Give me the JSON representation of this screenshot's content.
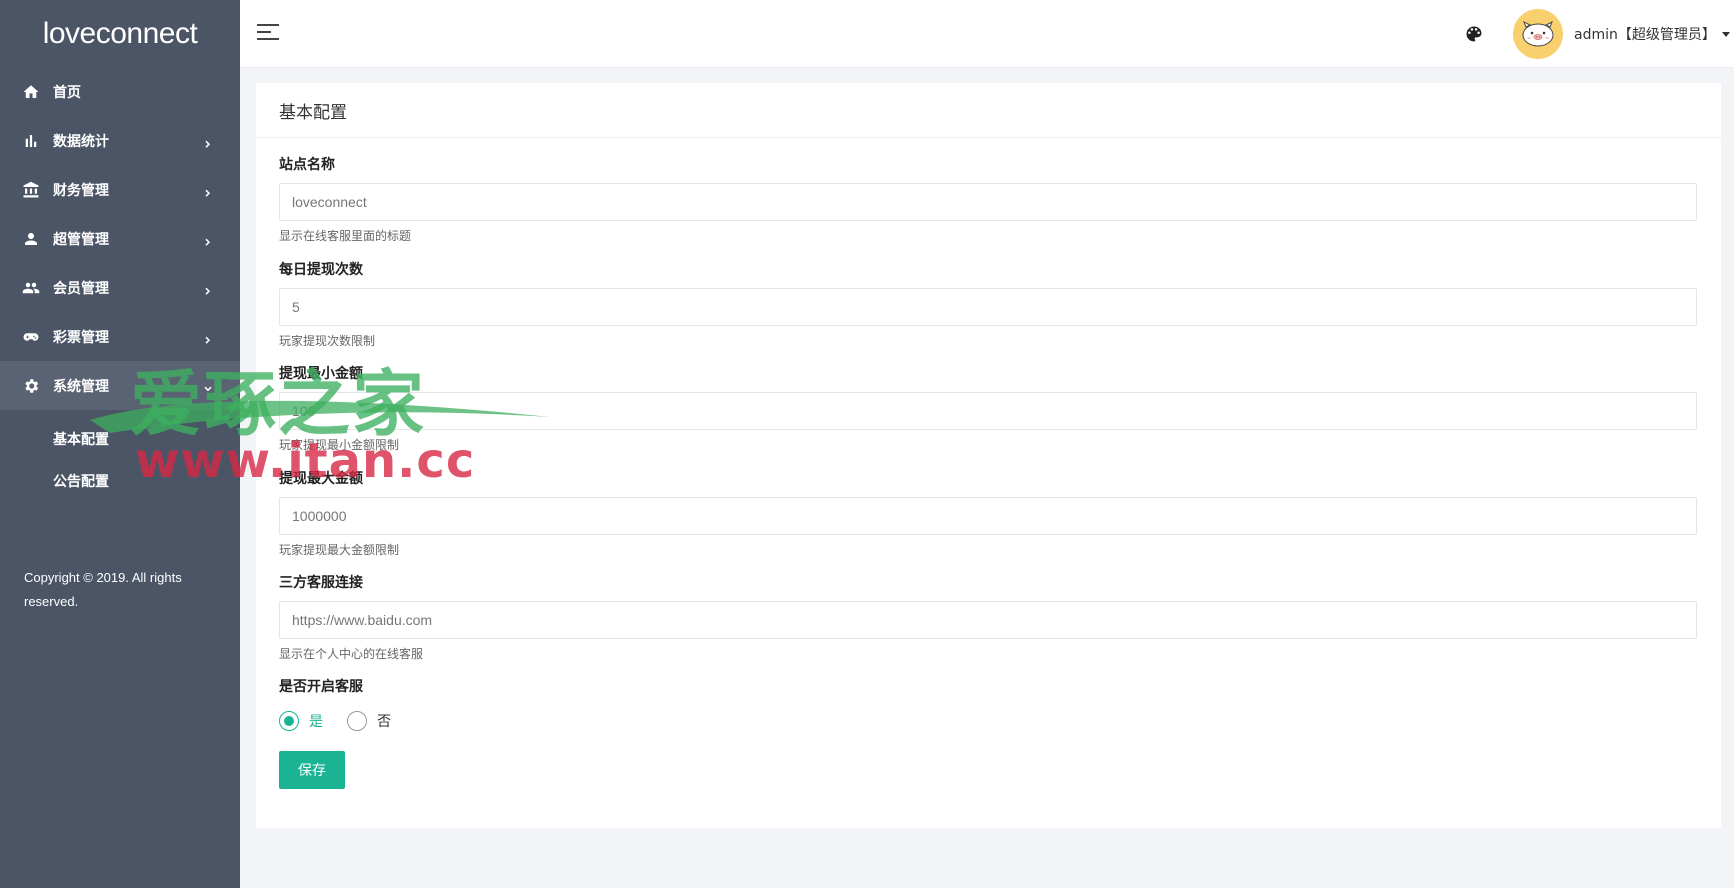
{
  "app": {
    "brand": "loveconnect"
  },
  "sidebar": {
    "items": [
      {
        "label": "首页",
        "icon": "home-icon",
        "has_children": false
      },
      {
        "label": "数据统计",
        "icon": "bar-chart-icon",
        "has_children": true
      },
      {
        "label": "财务管理",
        "icon": "bank-icon",
        "has_children": true
      },
      {
        "label": "超管管理",
        "icon": "person-icon",
        "has_children": true
      },
      {
        "label": "会员管理",
        "icon": "people-icon",
        "has_children": true
      },
      {
        "label": "彩票管理",
        "icon": "gamepad-icon",
        "has_children": true
      },
      {
        "label": "系统管理",
        "icon": "gear-icon",
        "has_children": true,
        "expanded": true
      }
    ],
    "subitems": [
      {
        "label": "基本配置"
      },
      {
        "label": "公告配置"
      }
    ],
    "copyright": "Copyright © 2019. All rights reserved."
  },
  "topbar": {
    "user_label": "admin【超级管理员】"
  },
  "card": {
    "title": "基本配置",
    "fields": [
      {
        "label": "站点名称",
        "value": "loveconnect",
        "help": "显示在线客服里面的标题"
      },
      {
        "label": "每日提现次数",
        "value": "5",
        "help": "玩家提现次数限制"
      },
      {
        "label": "提现最小金额",
        "value": "100",
        "help": "玩家提现最小金额限制"
      },
      {
        "label": "提现最大金额",
        "value": "1000000",
        "help": "玩家提现最大金额限制"
      },
      {
        "label": "三方客服连接",
        "value": "https://www.baidu.com",
        "help": "显示在个人中心的在线客服"
      }
    ],
    "service_toggle": {
      "label": "是否开启客服",
      "options": [
        "是",
        "否"
      ],
      "selected": "是"
    },
    "save_label": "保存"
  },
  "watermark": {
    "line1": "爱琢之家",
    "line2": "www.itan.cc"
  },
  "colors": {
    "sidebar_bg": "#4b5565",
    "accent": "#1ab394",
    "avatar_bg": "#f8d06d"
  }
}
